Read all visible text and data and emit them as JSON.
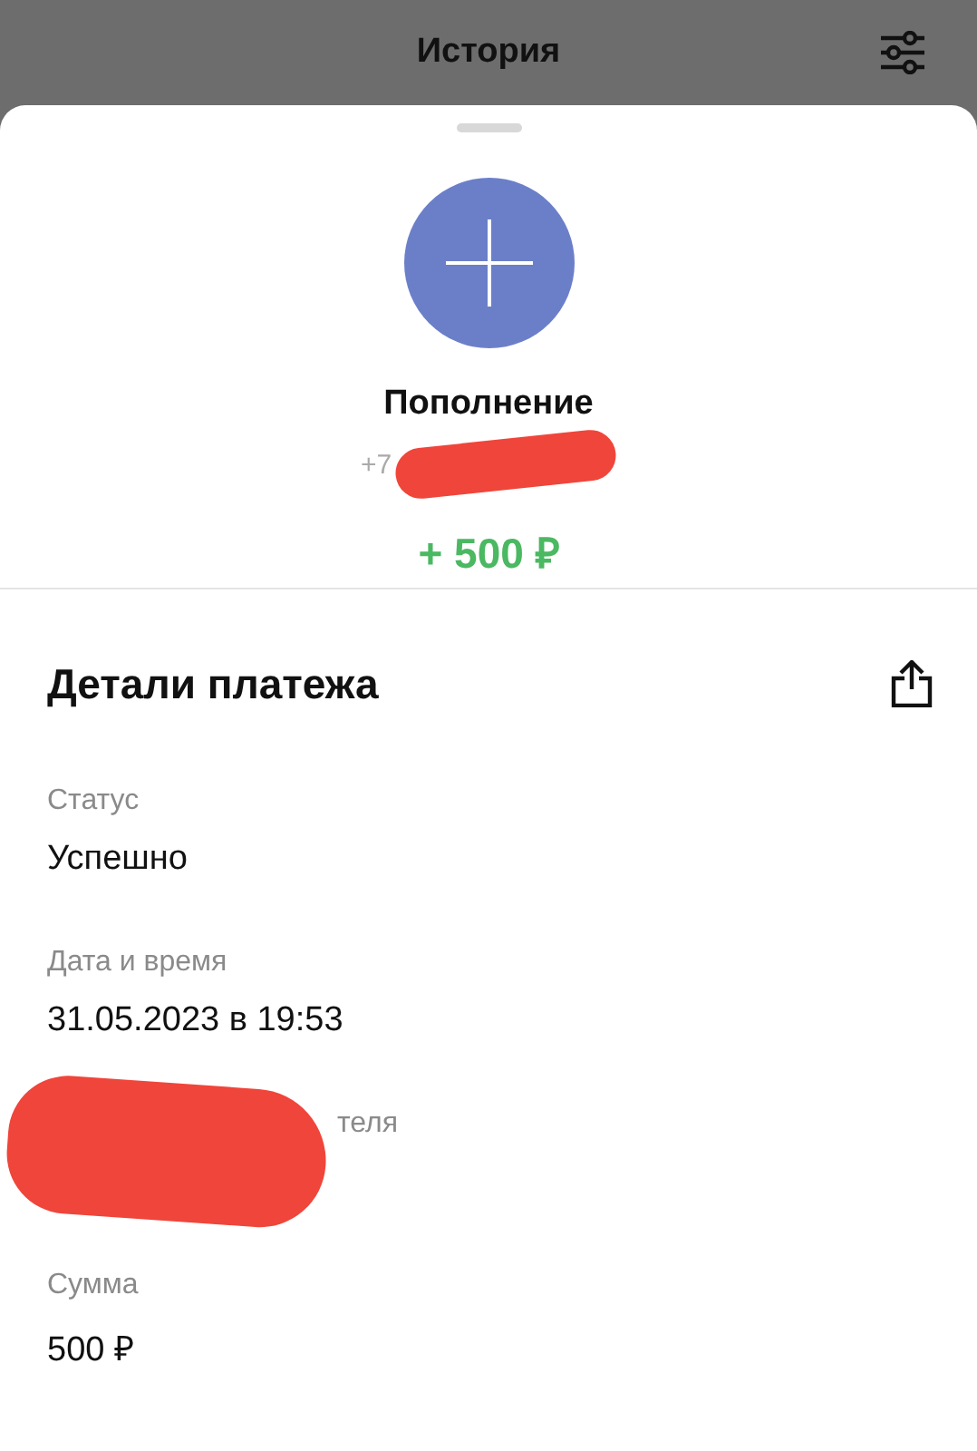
{
  "header": {
    "title": "История"
  },
  "operation": {
    "title": "Пополнение",
    "phone": "+7",
    "phone_redacted": true,
    "amount": "+ 500 ₽"
  },
  "details": {
    "title": "Детали платежа",
    "fields": [
      {
        "label": "Статус",
        "value": "Успешно",
        "redacted": false
      },
      {
        "label": "Дата и время",
        "value": "31.05.2023 в 19:53",
        "redacted": false
      },
      {
        "label": "теля",
        "redacted": true
      },
      {
        "label": "Сумма",
        "value": "500 ₽",
        "redacted": false
      }
    ]
  }
}
